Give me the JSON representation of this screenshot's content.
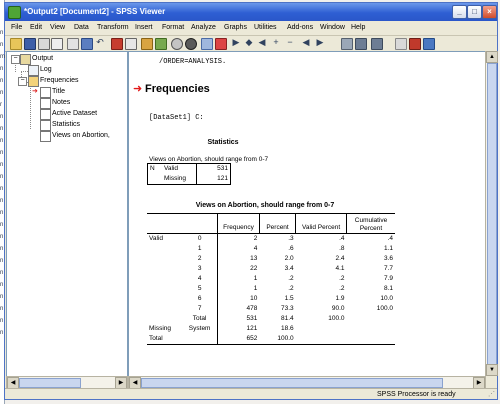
{
  "window": {
    "title": "*Output2 [Document2] - SPSS Viewer",
    "controls": {
      "minimize": "_",
      "maximize": "□",
      "close": "×"
    }
  },
  "menu": [
    "File",
    "Edit",
    "View",
    "Data",
    "Transform",
    "Insert",
    "Format",
    "Analyze",
    "Graphs",
    "Utilities",
    "Add-ons",
    "Window",
    "Help"
  ],
  "toolbar_icons": [
    "open-icon",
    "save-icon",
    "print-icon",
    "print-preview-icon",
    "export-icon",
    "dialog-recall-icon",
    "undo-icon",
    "goto-data-icon",
    "goto-case-icon",
    "variables-icon",
    "use-sets-icon",
    "designate-window-icon",
    "show-all-icon",
    "insert-heading-icon",
    "back-icon",
    "forward-icon",
    "promote-icon",
    "demote-icon",
    "expand-icon",
    "collapse-icon",
    "show-icon",
    "hide-icon",
    "insert-title-icon",
    "insert-text-icon",
    "pivot-icon"
  ],
  "outline": {
    "root": "Output",
    "log": "Log",
    "group": "Frequencies",
    "children": [
      "Title",
      "Notes",
      "Active Dataset",
      "Statistics",
      "Views on Abortion,"
    ]
  },
  "content": {
    "syntax_line": "/ORDER=ANALYSIS.",
    "section_heading": "Frequencies",
    "dataset_label": "[DataSet1] C:",
    "statistics_table": {
      "title": "Statistics",
      "variable_label": "Views on Abortion, should range from 0-7",
      "rows": [
        {
          "label": "N",
          "sublabel": "Valid",
          "value": "531"
        },
        {
          "label": "",
          "sublabel": "Missing",
          "value": "121"
        }
      ]
    },
    "frequency_table": {
      "title": "Views on Abortion, should range from 0-7",
      "headers": [
        "Frequency",
        "Percent",
        "Valid Percent",
        "Cumulative Percent"
      ],
      "rows": [
        {
          "group": "Valid",
          "category": "0",
          "frequency": "2",
          "percent": ".3",
          "valid_percent": ".4",
          "cumulative": ".4"
        },
        {
          "group": "",
          "category": "1",
          "frequency": "4",
          "percent": ".6",
          "valid_percent": ".8",
          "cumulative": "1.1"
        },
        {
          "group": "",
          "category": "2",
          "frequency": "13",
          "percent": "2.0",
          "valid_percent": "2.4",
          "cumulative": "3.6"
        },
        {
          "group": "",
          "category": "3",
          "frequency": "22",
          "percent": "3.4",
          "valid_percent": "4.1",
          "cumulative": "7.7"
        },
        {
          "group": "",
          "category": "4",
          "frequency": "1",
          "percent": ".2",
          "valid_percent": ".2",
          "cumulative": "7.9"
        },
        {
          "group": "",
          "category": "5",
          "frequency": "1",
          "percent": ".2",
          "valid_percent": ".2",
          "cumulative": "8.1"
        },
        {
          "group": "",
          "category": "6",
          "frequency": "10",
          "percent": "1.5",
          "valid_percent": "1.9",
          "cumulative": "10.0"
        },
        {
          "group": "",
          "category": "7",
          "frequency": "478",
          "percent": "73.3",
          "valid_percent": "90.0",
          "cumulative": "100.0"
        },
        {
          "group": "",
          "category": "Total",
          "frequency": "531",
          "percent": "81.4",
          "valid_percent": "100.0",
          "cumulative": ""
        },
        {
          "group": "Missing",
          "category": "System",
          "frequency": "121",
          "percent": "18.6",
          "valid_percent": "",
          "cumulative": ""
        },
        {
          "group": "Total",
          "category": "",
          "frequency": "652",
          "percent": "100.0",
          "valid_percent": "",
          "cumulative": ""
        }
      ]
    }
  },
  "status": {
    "left": "",
    "processor": "SPSS  Processor is ready"
  },
  "background_edge_marks": [
    "n",
    "n",
    "m",
    "n",
    "n",
    "n",
    "r",
    "n",
    "n",
    "n",
    "n",
    "n",
    "n",
    "n",
    "n",
    "n",
    "n",
    "n",
    "n",
    "n",
    "n",
    "n",
    "n",
    "n",
    "n",
    "n"
  ]
}
